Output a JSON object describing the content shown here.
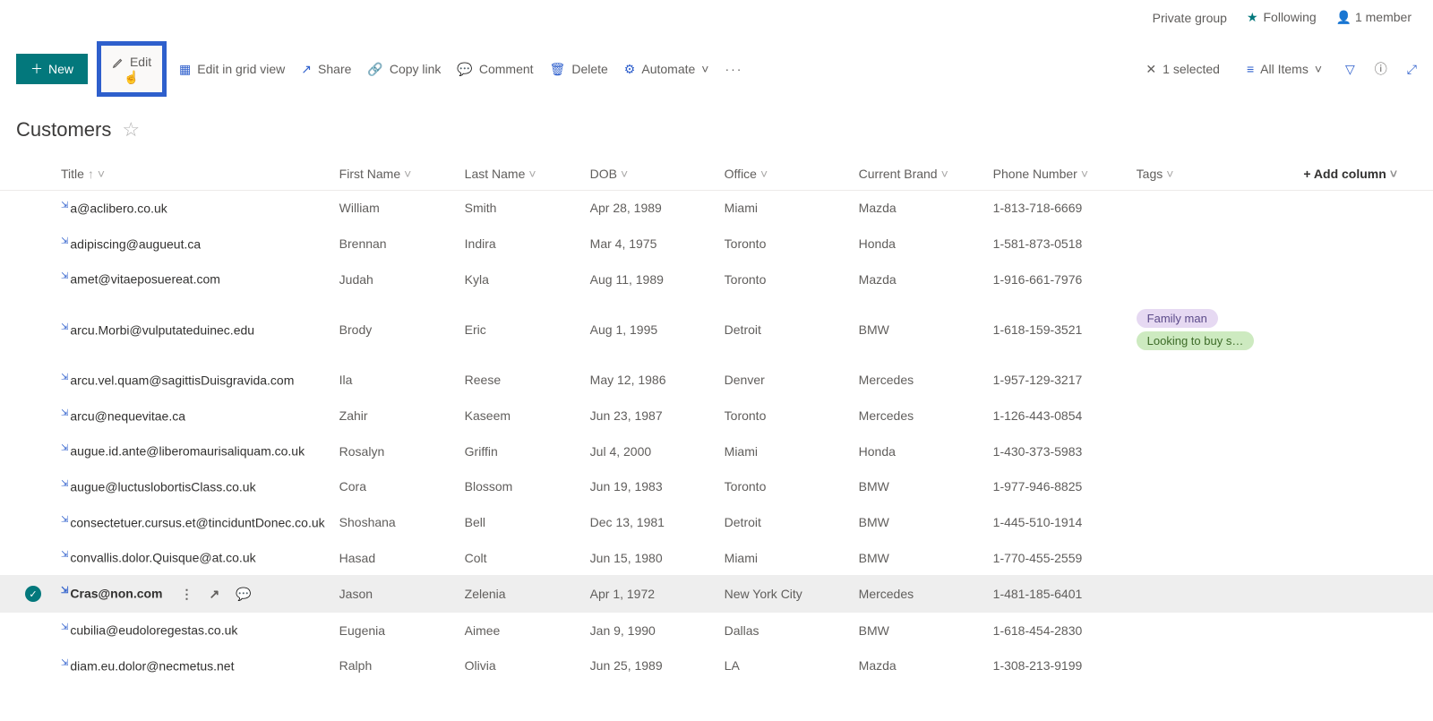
{
  "siteBar": {
    "group": "Private group",
    "following": "Following",
    "members": "1 member"
  },
  "commands": {
    "new": "New",
    "edit": "Edit",
    "editGrid": "Edit in grid view",
    "share": "Share",
    "copyLink": "Copy link",
    "comment": "Comment",
    "delete": "Delete",
    "automate": "Automate",
    "selected": "1 selected",
    "allItems": "All Items"
  },
  "list": {
    "title": "Customers"
  },
  "columns": {
    "title": "Title",
    "firstName": "First Name",
    "lastName": "Last Name",
    "dob": "DOB",
    "office": "Office",
    "brand": "Current Brand",
    "phone": "Phone Number",
    "tags": "Tags",
    "add": "Add column"
  },
  "rows": [
    {
      "title": "a@aclibero.co.uk",
      "fn": "William",
      "ln": "Smith",
      "dob": "Apr 28, 1989",
      "office": "Miami",
      "brand": "Mazda",
      "phone": "1-813-718-6669",
      "tags": [],
      "selected": false
    },
    {
      "title": "adipiscing@augueut.ca",
      "fn": "Brennan",
      "ln": "Indira",
      "dob": "Mar 4, 1975",
      "office": "Toronto",
      "brand": "Honda",
      "phone": "1-581-873-0518",
      "tags": [],
      "selected": false
    },
    {
      "title": "amet@vitaeposuereat.com",
      "fn": "Judah",
      "ln": "Kyla",
      "dob": "Aug 11, 1989",
      "office": "Toronto",
      "brand": "Mazda",
      "phone": "1-916-661-7976",
      "tags": [],
      "selected": false
    },
    {
      "title": "arcu.Morbi@vulputateduinec.edu",
      "fn": "Brody",
      "ln": "Eric",
      "dob": "Aug 1, 1995",
      "office": "Detroit",
      "brand": "BMW",
      "phone": "1-618-159-3521",
      "tags": [
        {
          "text": "Family man",
          "c": "purple"
        },
        {
          "text": "Looking to buy s…",
          "c": "green"
        }
      ],
      "selected": false
    },
    {
      "title": "arcu.vel.quam@sagittisDuisgravida.com",
      "fn": "Ila",
      "ln": "Reese",
      "dob": "May 12, 1986",
      "office": "Denver",
      "brand": "Mercedes",
      "phone": "1-957-129-3217",
      "tags": [],
      "selected": false
    },
    {
      "title": "arcu@nequevitae.ca",
      "fn": "Zahir",
      "ln": "Kaseem",
      "dob": "Jun 23, 1987",
      "office": "Toronto",
      "brand": "Mercedes",
      "phone": "1-126-443-0854",
      "tags": [],
      "selected": false
    },
    {
      "title": "augue.id.ante@liberomaurisaliquam.co.uk",
      "fn": "Rosalyn",
      "ln": "Griffin",
      "dob": "Jul 4, 2000",
      "office": "Miami",
      "brand": "Honda",
      "phone": "1-430-373-5983",
      "tags": [],
      "selected": false
    },
    {
      "title": "augue@luctuslobortisClass.co.uk",
      "fn": "Cora",
      "ln": "Blossom",
      "dob": "Jun 19, 1983",
      "office": "Toronto",
      "brand": "BMW",
      "phone": "1-977-946-8825",
      "tags": [],
      "selected": false
    },
    {
      "title": "consectetuer.cursus.et@tinciduntDonec.co.uk",
      "fn": "Shoshana",
      "ln": "Bell",
      "dob": "Dec 13, 1981",
      "office": "Detroit",
      "brand": "BMW",
      "phone": "1-445-510-1914",
      "tags": [],
      "selected": false
    },
    {
      "title": "convallis.dolor.Quisque@at.co.uk",
      "fn": "Hasad",
      "ln": "Colt",
      "dob": "Jun 15, 1980",
      "office": "Miami",
      "brand": "BMW",
      "phone": "1-770-455-2559",
      "tags": [],
      "selected": false
    },
    {
      "title": "Cras@non.com",
      "fn": "Jason",
      "ln": "Zelenia",
      "dob": "Apr 1, 1972",
      "office": "New York City",
      "brand": "Mercedes",
      "phone": "1-481-185-6401",
      "tags": [],
      "selected": true
    },
    {
      "title": "cubilia@eudoloregestas.co.uk",
      "fn": "Eugenia",
      "ln": "Aimee",
      "dob": "Jan 9, 1990",
      "office": "Dallas",
      "brand": "BMW",
      "phone": "1-618-454-2830",
      "tags": [],
      "selected": false
    },
    {
      "title": "diam.eu.dolor@necmetus.net",
      "fn": "Ralph",
      "ln": "Olivia",
      "dob": "Jun 25, 1989",
      "office": "LA",
      "brand": "Mazda",
      "phone": "1-308-213-9199",
      "tags": [],
      "selected": false
    }
  ]
}
